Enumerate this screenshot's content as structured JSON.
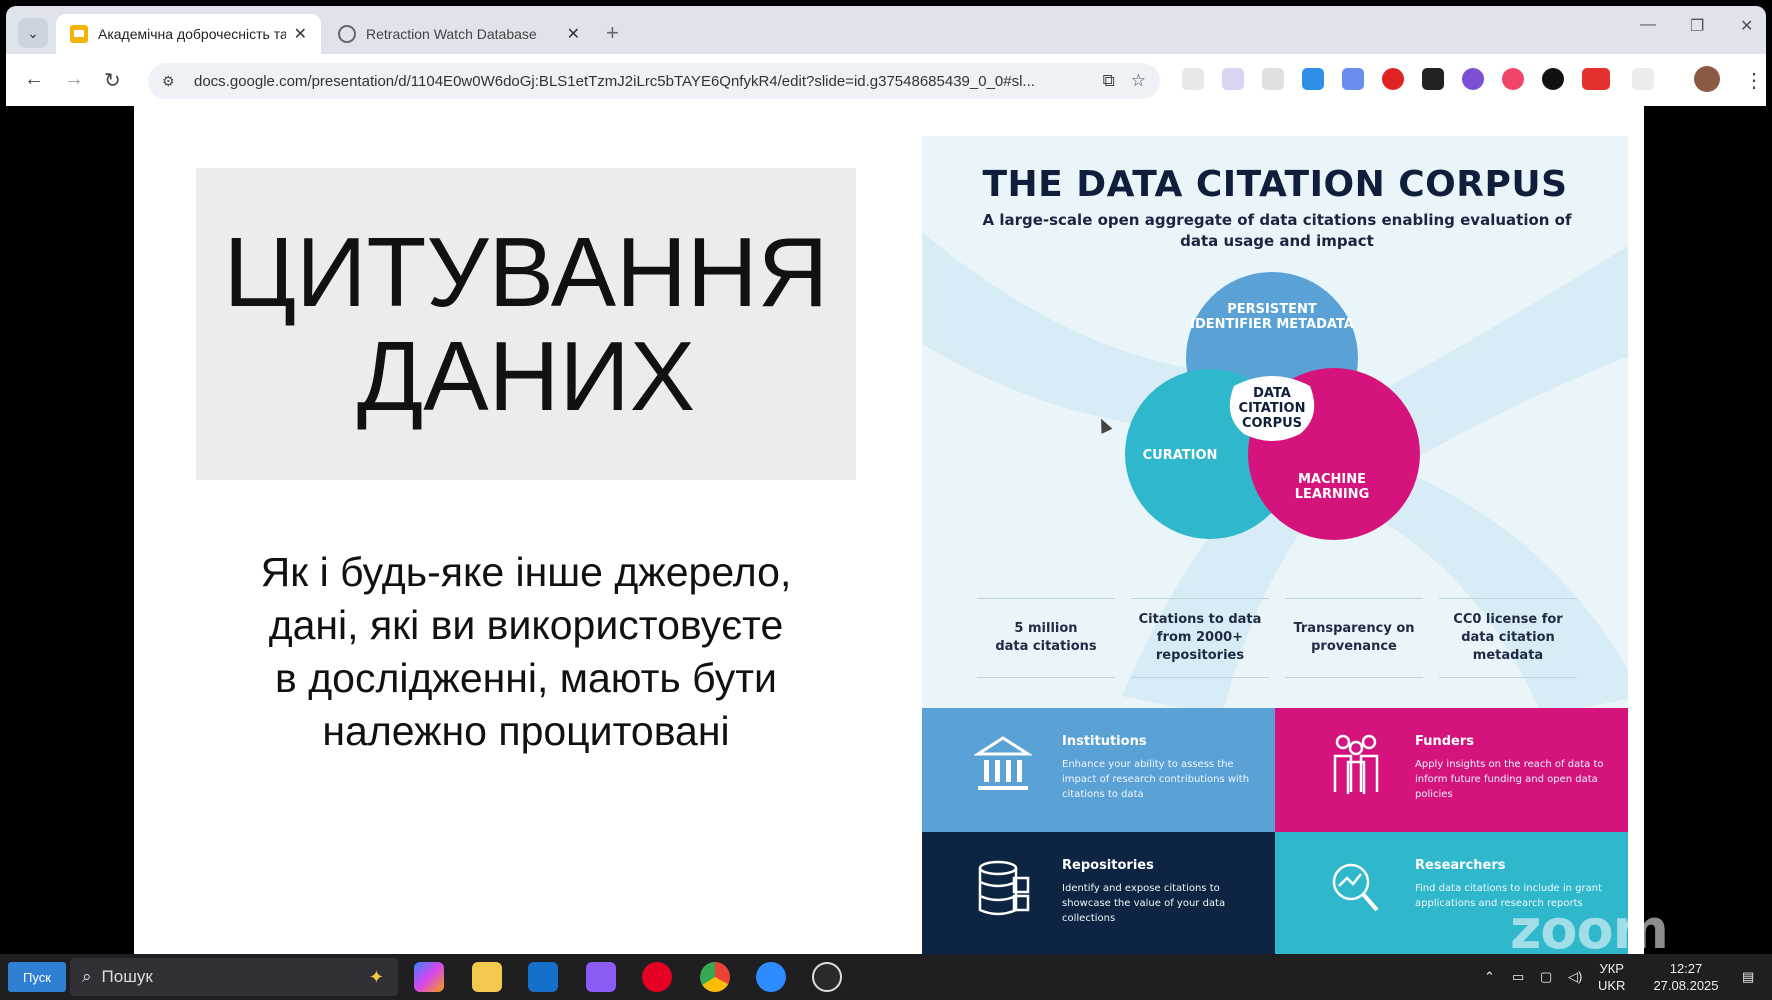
{
  "browser": {
    "tabs": [
      {
        "label": "Академічна доброчесність та",
        "close": "✕",
        "active": true
      },
      {
        "label": "Retraction Watch Database",
        "close": "✕",
        "active": false
      }
    ],
    "new_tab": "+",
    "url": "docs.google.com/presentation/d/1104E0w0W6doGj:BLS1etTzmJ2iLrc5bTAYE6QnfykR4/edit?slide=id.g37548685439_0_0#sl...",
    "window_controls": [
      "—",
      "❐",
      "✕"
    ]
  },
  "slide": {
    "title": "ЦИТУВАННЯ\nДАНИХ",
    "body": "Як і будь-яке інше джерело,\nдані, які ви використовуєте\nв дослідженні, мають бути\nналежно процитовані"
  },
  "infographic": {
    "title": "THE DATA CITATION CORPUS",
    "subtitle": "A large-scale open aggregate of data citations enabling evaluation of data usage and impact",
    "venn": {
      "top": "PERSISTENT\nIDENTIFIER METADATA",
      "left": "CURATION",
      "right": "MACHINE\nLEARNING",
      "center": "DATA\nCITATION\nCORPUS"
    },
    "stats": [
      "5 million\ndata citations",
      "Citations to data\nfrom 2000+\nrepositories",
      "Transparency on\nprovenance",
      "CC0 license for\ndata citation\nmetadata"
    ],
    "audiences": [
      {
        "heading": "Institutions",
        "text": "Enhance your ability to assess the impact of research contributions with citations to data",
        "icon": "institution-icon"
      },
      {
        "heading": "Funders",
        "text": "Apply insights on the reach of data to inform future funding and open data policies",
        "icon": "people-group-icon"
      },
      {
        "heading": "Repositories",
        "text": "Identify and expose citations to showcase the value of your data collections",
        "icon": "database-icon"
      },
      {
        "heading": "Researchers",
        "text": "Find data citations to include in grant applications and research reports",
        "icon": "magnifier-chart-icon"
      }
    ],
    "colors": {
      "blue": "#5aa2d6",
      "magenta": "#d4137d",
      "navy": "#0d2543",
      "teal": "#2fb7cc"
    }
  },
  "overlay": {
    "zoom_watermark": "zoom"
  },
  "taskbar": {
    "start_label": "Пуск",
    "search_placeholder": "Пошук",
    "lang_line1": "УКР",
    "lang_line2": "UKR",
    "time": "12:27",
    "date": "27.08.2025"
  }
}
